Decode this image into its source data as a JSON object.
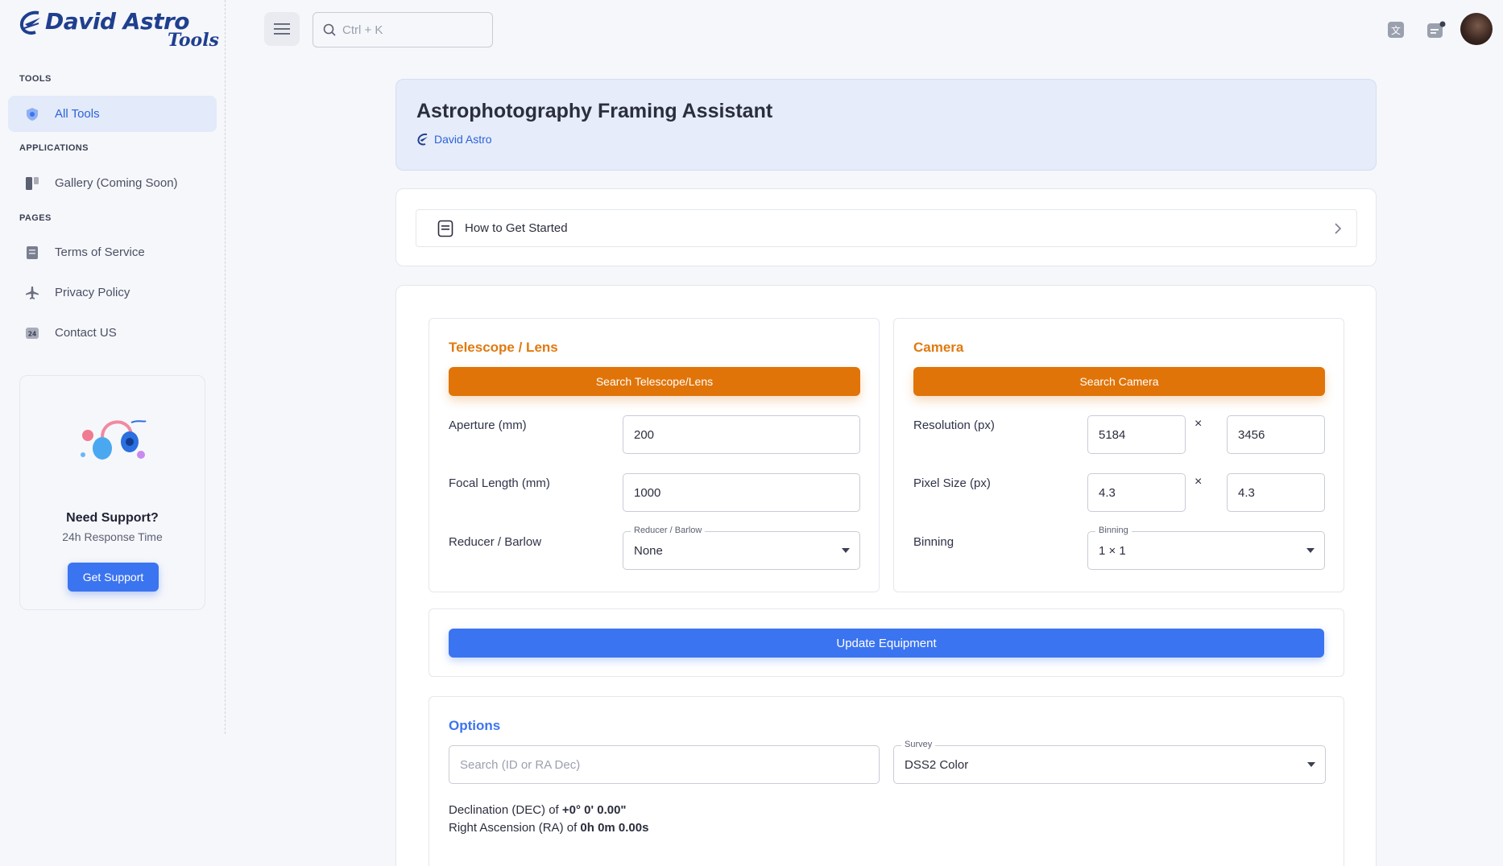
{
  "brand": {
    "name": "David Astro",
    "sub": "Tools"
  },
  "sidebar": {
    "sections": [
      {
        "label": "TOOLS"
      },
      {
        "label": "APPLICATIONS"
      },
      {
        "label": "PAGES"
      }
    ],
    "items": [
      {
        "label": "All Tools",
        "icon": "shield-icon"
      },
      {
        "label": "Gallery (Coming Soon)",
        "icon": "gallery-icon"
      },
      {
        "label": "Terms of Service",
        "icon": "document-icon"
      },
      {
        "label": "Privacy Policy",
        "icon": "airplane-icon"
      },
      {
        "label": "Contact US",
        "icon": "support-24-icon"
      }
    ],
    "support": {
      "title": "Need Support?",
      "subtitle": "24h Response Time",
      "button": "Get Support"
    }
  },
  "topbar": {
    "search_placeholder": "Ctrl + K"
  },
  "header": {
    "title": "Astrophotography Framing Assistant",
    "author": "David Astro"
  },
  "howto": {
    "label": "How to Get Started"
  },
  "telescope": {
    "title": "Telescope / Lens",
    "search_button": "Search Telescope/Lens",
    "aperture_label": "Aperture (mm)",
    "aperture_value": "200",
    "focal_label": "Focal Length (mm)",
    "focal_value": "1000",
    "reducer_label": "Reducer / Barlow",
    "reducer_float": "Reducer / Barlow",
    "reducer_value": "None"
  },
  "camera": {
    "title": "Camera",
    "search_button": "Search Camera",
    "resolution_label": "Resolution (px)",
    "resolution_w": "5184",
    "resolution_h": "3456",
    "pixel_label": "Pixel Size (px)",
    "pixel_w": "4.3",
    "pixel_h": "4.3",
    "times": "×",
    "binning_label": "Binning",
    "binning_float": "Binning",
    "binning_value": "1 × 1"
  },
  "update_button": "Update Equipment",
  "options": {
    "title": "Options",
    "search_placeholder": "Search (ID or RA Dec)",
    "survey_float": "Survey",
    "survey_value": "DSS2 Color",
    "dec_prefix": "Declination (DEC) of ",
    "dec_value": "+0° 0' 0.00\"",
    "ra_prefix": "Right Ascension (RA) of ",
    "ra_value": "0h 0m 0.00s"
  },
  "colors": {
    "accent_blue": "#3b74f0",
    "accent_orange": "#e07408",
    "brand_navy": "#1f3f8f"
  }
}
